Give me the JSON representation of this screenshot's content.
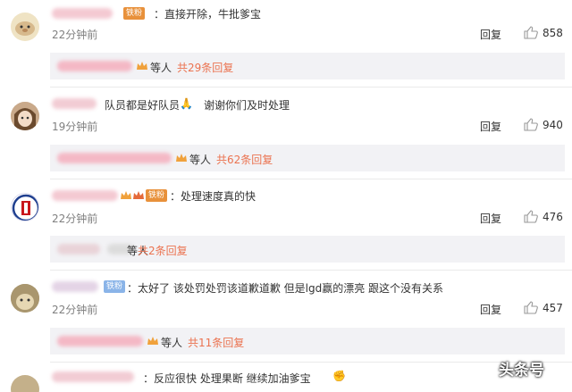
{
  "comments": [
    {
      "text": "：直接开除，牛批爹宝",
      "time": "22分钟前",
      "reply_label": "回复",
      "likes": "858",
      "badge": "铁粉",
      "sub": {
        "etc": "等人",
        "total": "共29条回复"
      }
    },
    {
      "text": "队员都是好队员",
      "emoji": "🙏",
      "text2": "谢谢你们及时处理",
      "time": "19分钟前",
      "reply_label": "回复",
      "likes": "940",
      "sub": {
        "etc": "等人",
        "total": "共62条回复"
      }
    },
    {
      "text": "：处理速度真的快",
      "time": "22分钟前",
      "reply_label": "回复",
      "likes": "476",
      "badge": "铁粉",
      "sub": {
        "etc": "等人",
        "total": "共2条回复"
      }
    },
    {
      "text": "：太好了 该处罚处罚该道歉道歉 但是lgd赢的漂亮 跟这个没有关系",
      "time": "22分钟前",
      "reply_label": "回复",
      "likes": "457",
      "badge": "铁粉",
      "sub": {
        "etc": "等人",
        "total": "共11条回复"
      }
    },
    {
      "text": "：反应很快 处理果断 继续加油爹宝",
      "emoji": "✊"
    }
  ],
  "watermark": "头条号"
}
